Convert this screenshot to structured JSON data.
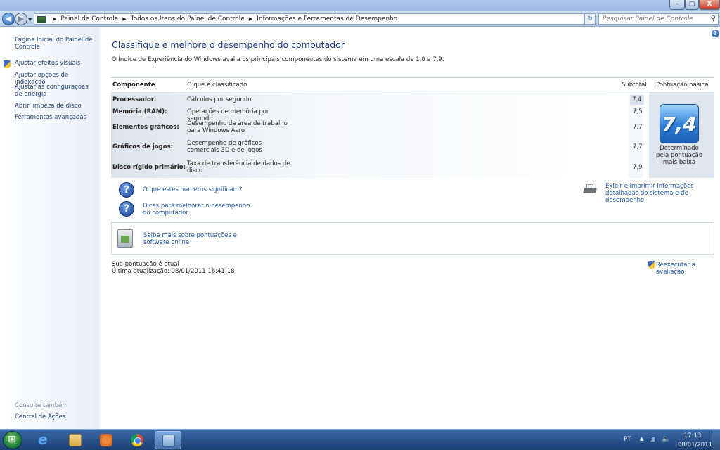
{
  "window": {
    "min_glyph": "–",
    "max_glyph": "▢",
    "close_glyph": "X"
  },
  "navbar": {
    "back_glyph": "◀",
    "fwd_glyph": "▶",
    "breadcrumbs": [
      "Painel de Controle",
      "Todos os Itens do Painel de Controle",
      "Informações e Ferramentas de Desempenho"
    ],
    "crumb_sep": "▶",
    "search_placeholder": "Pesquisar Painel de Controle",
    "search_glyph": "⚲",
    "refresh_glyph": "↻",
    "dropdown_glyph": "▼"
  },
  "sidebar": {
    "items": [
      {
        "label": "Página Inicial do Painel de Controle"
      },
      {
        "label": "Ajustar efeitos visuais"
      },
      {
        "label": "Ajustar opções de indexação"
      },
      {
        "label": "Ajustar as configurações de energia"
      },
      {
        "label": "Abrir limpeza de disco"
      },
      {
        "label": "Ferramentas avançadas"
      }
    ],
    "see_also": "Consulte também",
    "action_center": "Central de Ações"
  },
  "main": {
    "title": "Classifique e melhore o desempenho do computador",
    "description": "O Índice de Experiência do Windows avalia os principais componentes do sistema em uma escala de 1,0 a 7,9.",
    "headers": {
      "component": "Componente",
      "rated": "O que é classificado",
      "subtotal": "Subtotal",
      "base": "Pontuação básica"
    },
    "rows": [
      {
        "component": "Processador:",
        "rated": "Cálculos por segundo",
        "subtotal": "7,4"
      },
      {
        "component": "Memória (RAM):",
        "rated": "Operações de memória por segundo",
        "subtotal": "7,5"
      },
      {
        "component": "Elementos gráficos:",
        "rated": "Desempenho da área de trabalho para Windows Aero",
        "subtotal": "7,7"
      },
      {
        "component": "Gráficos de jogos:",
        "rated": "Desempenho de gráficos comerciais 3D e de jogos",
        "subtotal": "7,7"
      },
      {
        "component": "Disco rígido primário:",
        "rated": "Taxa de transferência de dados de disco",
        "subtotal": "7,9"
      }
    ],
    "base_score": "7,4",
    "base_caption": "Determinado pela pontuação mais baixa",
    "help_links": [
      "O que estes números significam?",
      "Dicas para melhorar o desempenho do computador."
    ],
    "print_link": "Exibir e imprimir informações detalhadas do sistema e de desempenho",
    "online_link": "Saiba mais sobre pontuações e software online",
    "status_current": "Sua pontuação é atual",
    "status_updated": "Última atualização: 08/01/2011 16:41:18",
    "rerun_link": "Reexecutar a avaliação"
  },
  "taskbar": {
    "lang": "PT",
    "tray_arrow": "▲",
    "net_glyph": ".ıll",
    "vol_glyph": "🔈",
    "ie_glyph": "e",
    "time": "17:13",
    "date": "08/01/2011"
  }
}
